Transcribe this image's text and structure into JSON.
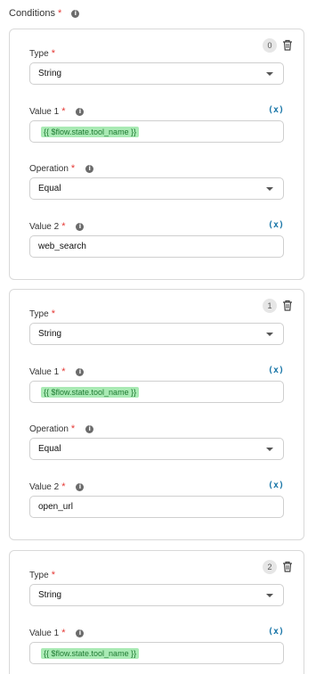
{
  "conditions": {
    "label": "Conditions",
    "required_mark": "*",
    "info": "i"
  },
  "cards": [
    {
      "index": "0",
      "type_label": "Type",
      "type_value": "String",
      "value1_label": "Value 1",
      "value1_var": "{{ $flow.state.tool_name }}",
      "operation_label": "Operation",
      "operation_value": "Equal",
      "value2_label": "Value 2",
      "value2_value": "web_search",
      "var_toggle": "(x)"
    },
    {
      "index": "1",
      "type_label": "Type",
      "type_value": "String",
      "value1_label": "Value 1",
      "value1_var": "{{ $flow.state.tool_name }}",
      "operation_label": "Operation",
      "operation_value": "Equal",
      "value2_label": "Value 2",
      "value2_value": "open_url",
      "var_toggle": "(x)"
    },
    {
      "index": "2",
      "type_label": "Type",
      "type_value": "String",
      "value1_label": "Value 1",
      "value1_var": "{{ $flow.state.tool_name }}",
      "var_toggle": "(x)"
    }
  ],
  "colors": {
    "required": "#e53935",
    "accent": "#1976a8",
    "chip_bg": "#a9eab4",
    "chip_text": "#1f7a33"
  }
}
